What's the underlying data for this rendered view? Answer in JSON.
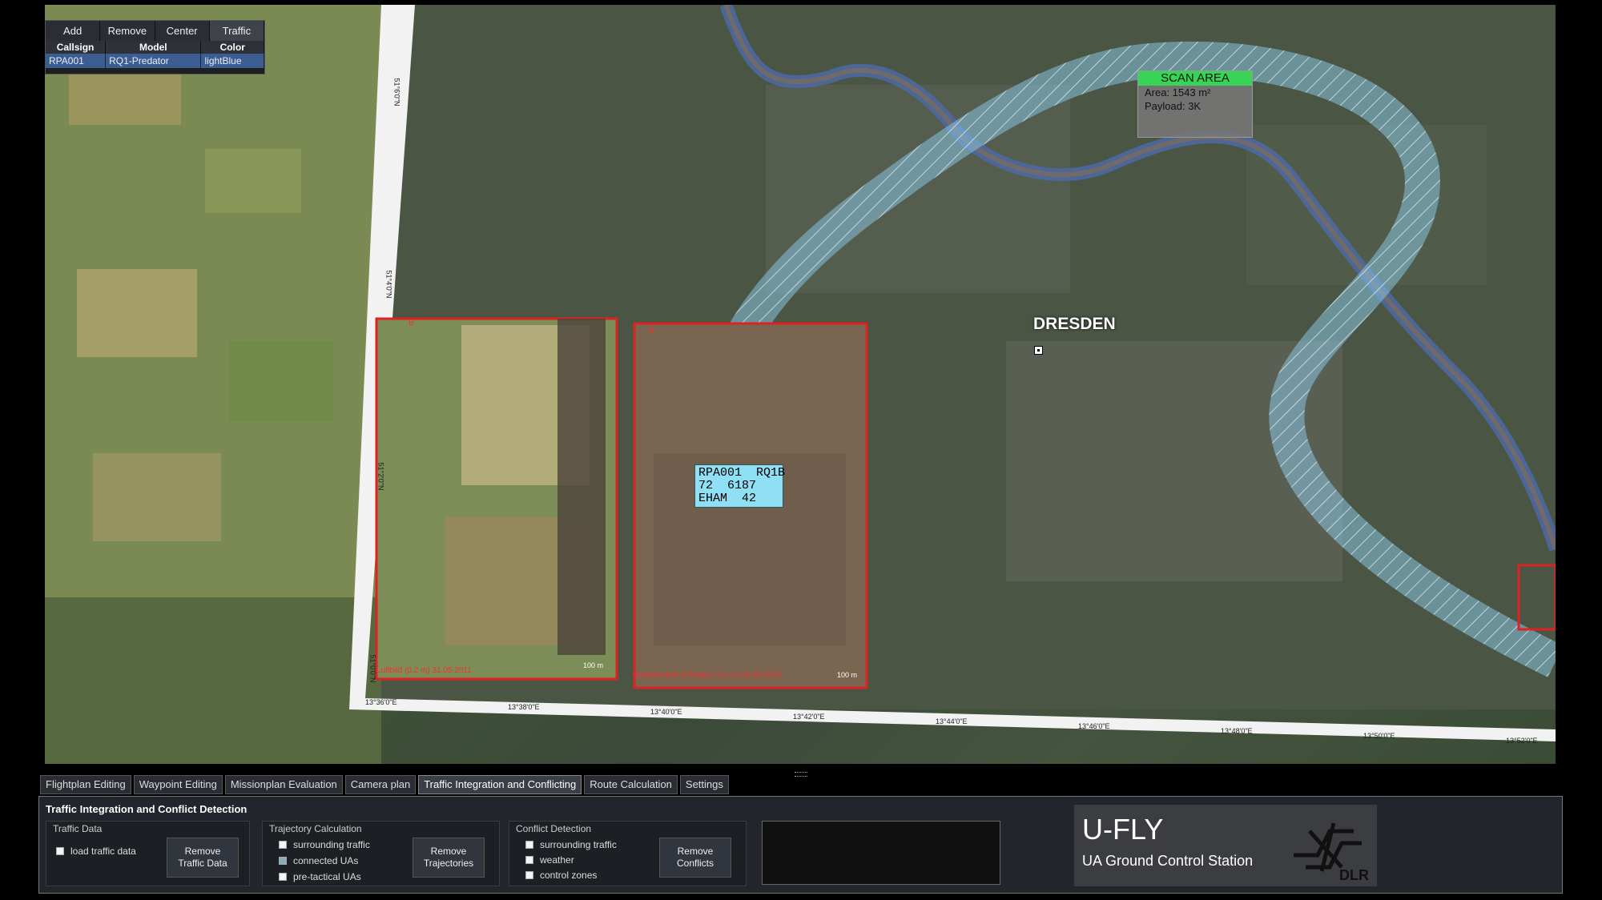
{
  "traffic": {
    "toolbar": [
      "Add",
      "Remove",
      "Center",
      "Traffic"
    ],
    "columns": [
      "Callsign",
      "Model",
      "Color"
    ],
    "rows": [
      [
        "RPA001",
        "RQ1-Predator",
        "lightBlue"
      ]
    ]
  },
  "map": {
    "scan_area": {
      "title": "SCAN AREA",
      "area": "Area: 1543 m²",
      "payload": "Payload: 3K"
    },
    "city": "DRESDEN",
    "uav_label": {
      "line1": "RPA001  RQ1B",
      "line2": "72  6187",
      "line3": "EHAM  42"
    },
    "overlay_left_caption": "Luftbild (0,2 m)  31.05.2011",
    "overlay_right_caption": "Satellitenbild (Pléiades 0,5 m)  09.06.2013",
    "scale_label": "100 m",
    "overlay_marker": "B",
    "lon_ticks": [
      "13°36'0\"E",
      "13°38'0\"E",
      "13°40'0\"E",
      "13°42'0\"E",
      "13°44'0\"E",
      "13°46'0\"E",
      "13°48'0\"E",
      "13°50'0\"E",
      "13°52'0\"E"
    ],
    "lat_ticks": [
      "51°6'0\"N",
      "51°4'0\"N",
      "51°2'0\"N",
      "51°0'0\"N"
    ]
  },
  "tabs": [
    "Flightplan Editing",
    "Waypoint Editing",
    "Missionplan Evaluation",
    "Camera plan",
    "Traffic Integration and Conflicting",
    "Route Calculation",
    "Settings"
  ],
  "active_tab": "Traffic Integration and Conflicting",
  "panel": {
    "title": "Traffic Integration and Conflict Detection",
    "traffic_data": {
      "title": "Traffic Data",
      "checkbox": "load traffic data",
      "button_line1": "Remove",
      "button_line2": "Traffic Data"
    },
    "trajectory": {
      "title": "Trajectory Calculation",
      "options": [
        "surrounding traffic",
        "connected UAs",
        "pre-tactical UAs"
      ],
      "button_line1": "Remove",
      "button_line2": "Trajectories"
    },
    "conflict": {
      "title": "Conflict Detection",
      "options": [
        "surrounding traffic",
        "weather",
        "control zones"
      ],
      "button_line1": "Remove",
      "button_line2": "Conflicts"
    }
  },
  "logo": {
    "title": "U-FLY",
    "subtitle": "UA Ground Control Station",
    "org": "DLR"
  }
}
